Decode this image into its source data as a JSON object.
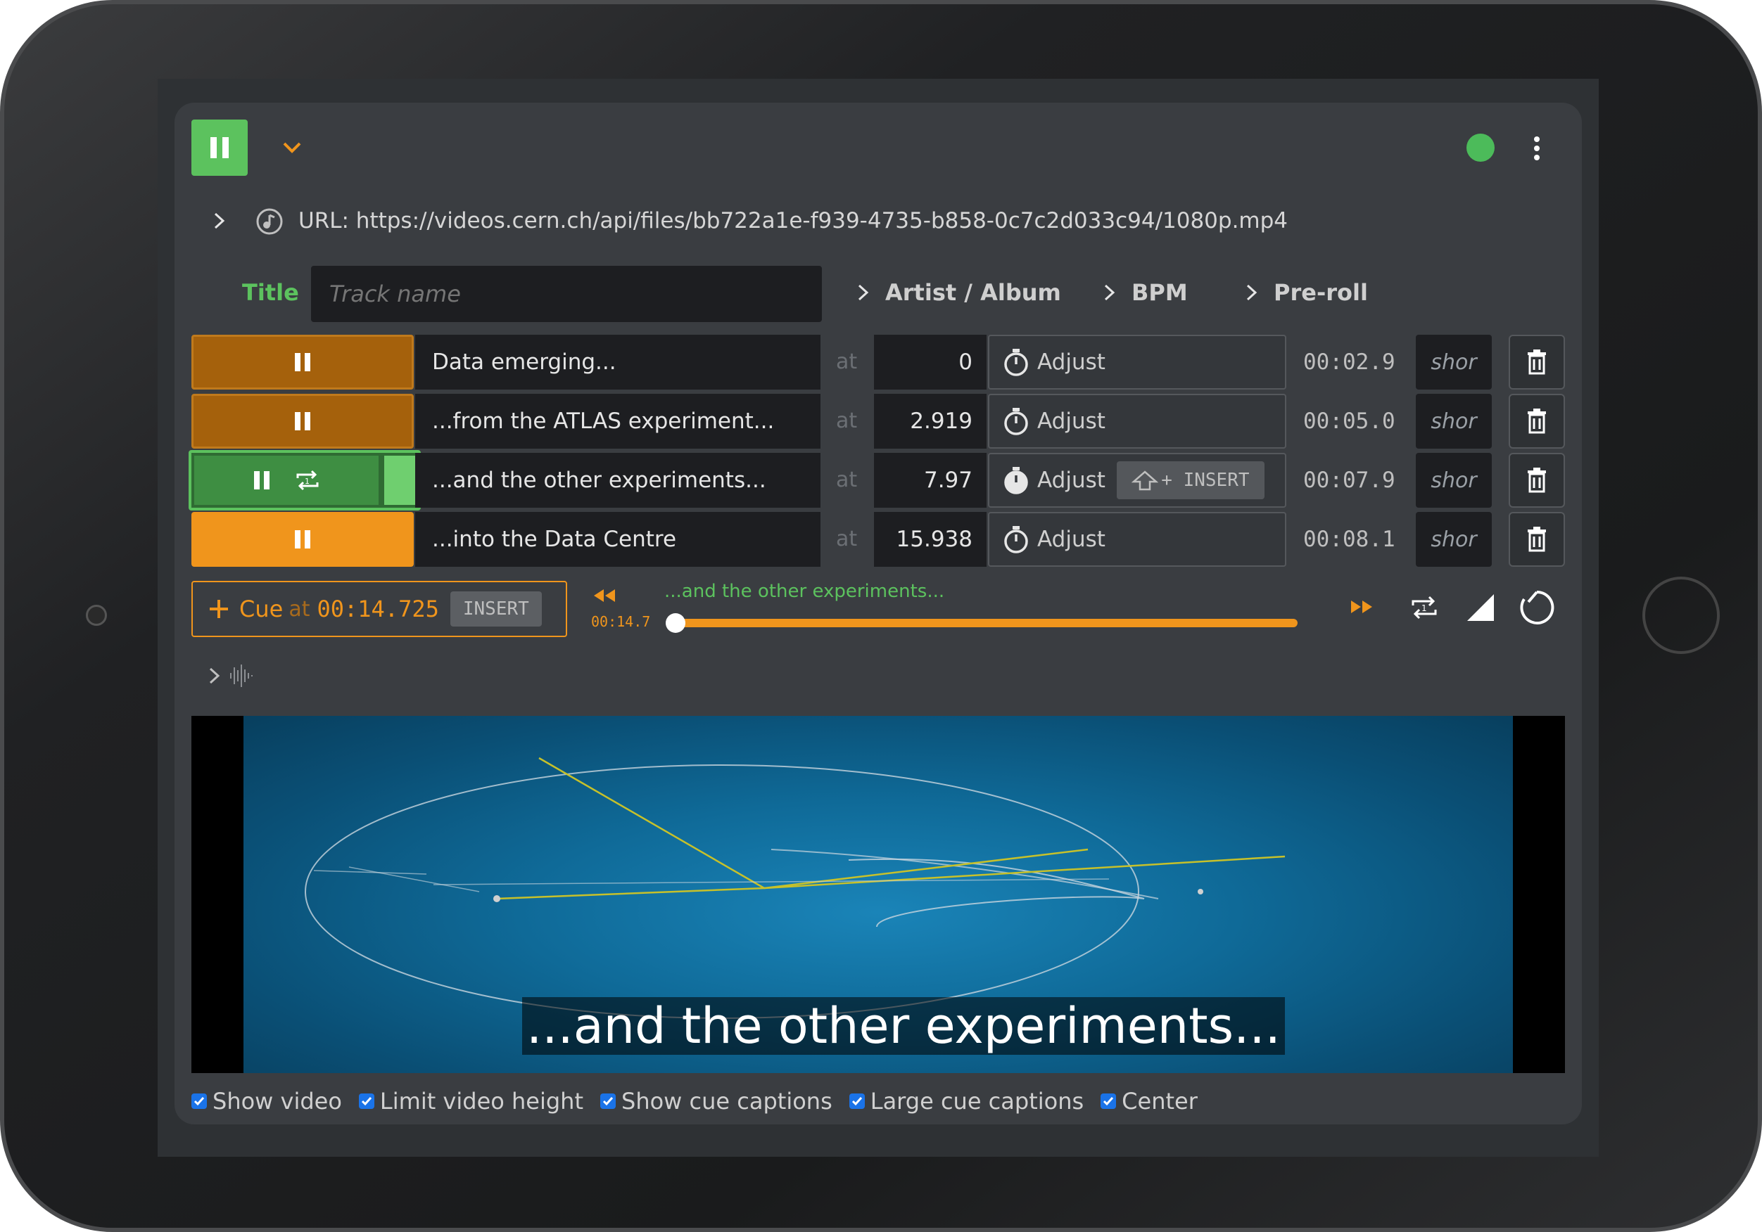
{
  "player": {
    "url_text": "URL: https://videos.cern.ch/api/files/bb722a1e-f939-4735-b858-0c7c2d033c94/1080p.mp4",
    "title_label": "Title",
    "title_placeholder": "Track name",
    "artist_album_label": "Artist / Album",
    "bpm_label": "BPM",
    "preroll_label": "Pre-roll",
    "status_color": "#4cbb5a"
  },
  "cues": [
    {
      "text": "Data emerging...",
      "at_label": "at",
      "at_value": "0",
      "adjust_label": "Adjust",
      "duration": "00:02.9",
      "shortcut": "shor"
    },
    {
      "text": "...from the ATLAS experiment...",
      "at_label": "at",
      "at_value": "2.919",
      "adjust_label": "Adjust",
      "duration": "00:05.0",
      "shortcut": "shor"
    },
    {
      "text": "...and the other experiments...",
      "at_label": "at",
      "at_value": "7.97",
      "adjust_label": "Adjust",
      "insert_label": "+ INSERT",
      "duration": "00:07.9",
      "shortcut": "shor"
    },
    {
      "text": "...into the Data Centre",
      "at_label": "at",
      "at_value": "15.938",
      "adjust_label": "Adjust",
      "duration": "00:08.1",
      "shortcut": "shor"
    }
  ],
  "new_cue": {
    "label": "Cue",
    "at_label": "at",
    "time": "00:14.725",
    "insert_label": "INSERT"
  },
  "transport": {
    "current_cue": "...and the other experiments...",
    "position": "00:14.7",
    "progress_fraction": 0.0
  },
  "video": {
    "caption": "...and the other experiments..."
  },
  "options": [
    {
      "label": "Show video",
      "checked": true
    },
    {
      "label": "Limit video height",
      "checked": true
    },
    {
      "label": "Show cue captions",
      "checked": true
    },
    {
      "label": "Large cue captions",
      "checked": true
    },
    {
      "label": "Center",
      "checked": true
    }
  ]
}
